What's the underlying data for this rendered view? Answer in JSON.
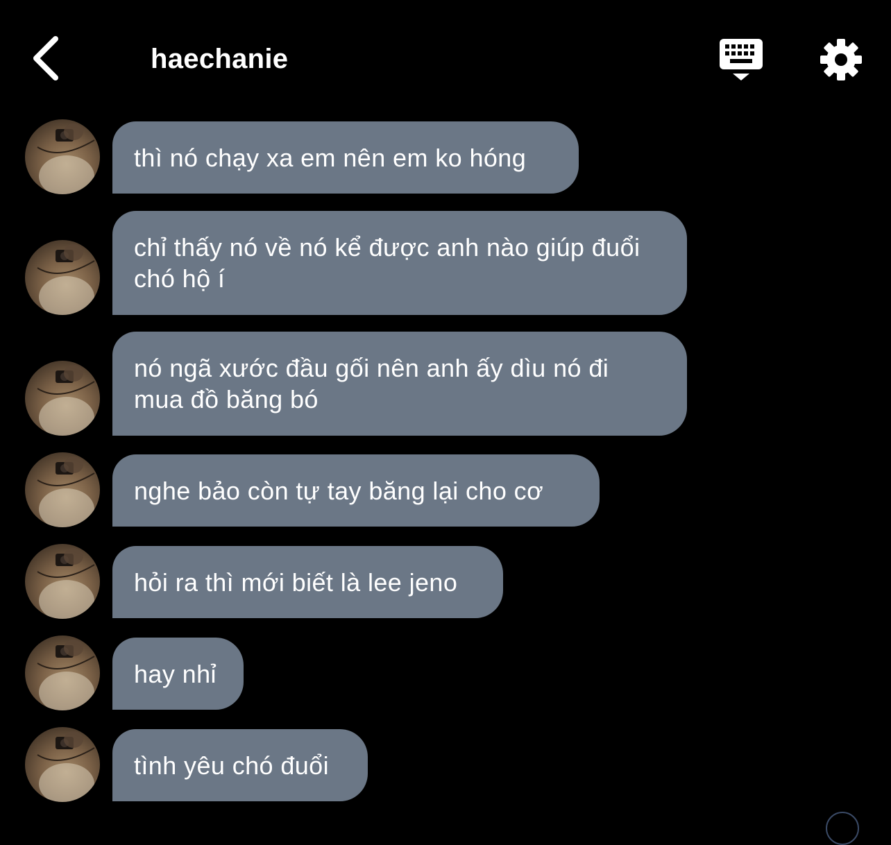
{
  "header": {
    "title": "haechanie"
  },
  "messages": [
    {
      "text": "thì nó chạy xa em nên em ko hóng"
    },
    {
      "text": "chỉ thấy nó về nó kể được anh nào giúp đuổi chó hộ í"
    },
    {
      "text": "nó ngã xước đầu gối nên anh ấy dìu nó đi mua đồ băng bó"
    },
    {
      "text": "nghe bảo còn tự tay băng lại cho cơ"
    },
    {
      "text": "hỏi ra thì mới biết là lee jeno"
    },
    {
      "text": "hay nhỉ"
    },
    {
      "text": "tình yêu chó đuổi"
    }
  ],
  "colors": {
    "background": "#000000",
    "bubble": "#6b7786",
    "text": "#ffffff"
  },
  "icons": {
    "back": "chevron-left-icon",
    "keyboard": "keyboard-hide-icon",
    "settings": "gear-icon"
  }
}
